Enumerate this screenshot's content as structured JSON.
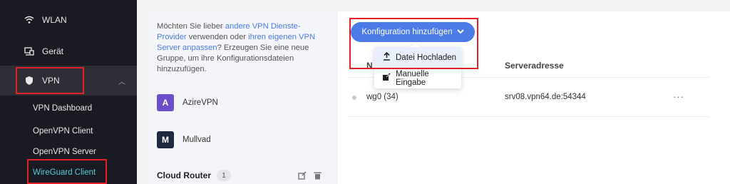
{
  "sidebar": {
    "wlan": {
      "label": "WLAN",
      "icon": "wifi-icon"
    },
    "device": {
      "label": "Gerät",
      "icon": "devices-icon"
    },
    "vpn": {
      "label": "VPN",
      "icon": "shield-icon"
    },
    "sub": [
      {
        "label": "VPN Dashboard"
      },
      {
        "label": "OpenVPN Client"
      },
      {
        "label": "OpenVPN Server"
      },
      {
        "label": "WireGuard Client"
      }
    ]
  },
  "info": {
    "part1": "Möchten Sie lieber ",
    "link1": "andere VPN Dienste-Provider",
    "part2": " verwenden oder ",
    "link2": "ihren eigenen VPN Server anpassen",
    "part3": "? Erzeugen Sie eine neue Gruppe, um ihre Konfigurationsdateien hinzuzufügen."
  },
  "providers": [
    {
      "initial": "A",
      "name": "AzireVPN",
      "color": "#6d4ec7"
    },
    {
      "initial": "M",
      "name": "Mullvad",
      "color": "#1f2b3d"
    }
  ],
  "group": {
    "name": "Cloud Router",
    "count": "1"
  },
  "toolbar": {
    "add_config_label": "Konfiguration hinzufügen"
  },
  "menu": [
    {
      "label": "Datei Hochladen",
      "icon": "upload-icon"
    },
    {
      "label": "Manuelle Eingabe",
      "icon": "edit-icon"
    }
  ],
  "table": {
    "col_name": "N",
    "col_server": "Serveradresse",
    "rows": [
      {
        "name": "wg0 (34)",
        "server": "srv08.vpn64.de:54344",
        "actions": "···"
      }
    ]
  },
  "colors": {
    "accent": "#4c7be8",
    "highlight": "#e1202a",
    "current": "#5bc8d8"
  }
}
